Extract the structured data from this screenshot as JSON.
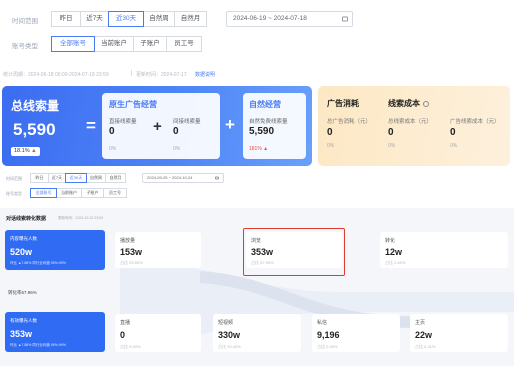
{
  "top_filters": {
    "time_label": "时间范围",
    "time_tabs": [
      "昨日",
      "近7天",
      "近30天",
      "自然周",
      "自然月"
    ],
    "date_range": "2024-06-19 ~ 2024-07-18",
    "account_label": "账号类型",
    "account_tabs": [
      "全部账号",
      "当前账户",
      "子账户",
      "员工号"
    ]
  },
  "meta": {
    "stat_period": "统计周期：2024-06-18 00:00-2024-07-18 23:59",
    "update_time": "更新时间：2024-07-17",
    "data_note": "数据说明"
  },
  "summary": {
    "total": {
      "title": "总线索量",
      "value": "5,590",
      "change": "18.1%"
    },
    "organic": {
      "title": "原生广告经营",
      "direct_label": "直接线索量",
      "direct_value": "0",
      "direct_pct": "0%",
      "indirect_label": "间接线索量",
      "indirect_value": "0",
      "indirect_pct": "0%"
    },
    "natural": {
      "title": "自然经营",
      "label": "自然免费线索量",
      "value": "5,590",
      "change": "181%"
    },
    "ads": {
      "title": "广告消耗",
      "lead_title": "线索成本",
      "spend_label": "总广告消耗（元）",
      "spend_value": "0",
      "spend_pct": "0%",
      "cost_label": "总线索成本（元）",
      "cost_value": "0",
      "cost_pct": "0%",
      "ad_cost_label": "广告线索成本（元）",
      "ad_cost_value": "0",
      "ad_cost_pct": "0%"
    }
  },
  "mid_filters": {
    "time_label": "时间范围",
    "time_tabs": [
      "昨日",
      "近7天",
      "近30天",
      "自然周",
      "自然月"
    ],
    "date_range": "2024-09-25 ~ 2024-10-24",
    "account_label": "账号类型",
    "account_tabs": [
      "全部账号",
      "当前账户",
      "子账户",
      "员工号"
    ]
  },
  "funnel": {
    "title": "对话线索转化数据",
    "update": "更新时间：2024-10-22 23:59",
    "exposure": {
      "title": "内容曝光人数",
      "value": "520w",
      "sub": "环比 ▲7.88%  同行业均值 95%-99%"
    },
    "conv_rate": "转化率67.96%",
    "engaged": {
      "title": "有效曝光人数",
      "value": "353w",
      "sub": "环比 ▲7.88%  同行业均值 95%-99%"
    },
    "cards_top": [
      {
        "title": "播放量",
        "value": "153w",
        "sub": "占比 29.55%"
      },
      {
        "title": "浏览",
        "value": "353w",
        "sub": "占比 67.99%"
      },
      {
        "title": "转化",
        "value": "12w",
        "sub": "占比 2.69%"
      }
    ],
    "cards_bottom": [
      {
        "title": "直播",
        "value": "0",
        "sub": "占比 0.00%"
      },
      {
        "title": "短视频",
        "value": "330w",
        "sub": "占比 93.43%"
      },
      {
        "title": "私信",
        "value": "9,196",
        "sub": "占比 0.26%"
      },
      {
        "title": "主页",
        "value": "22w",
        "sub": "占比 6.31%"
      }
    ]
  },
  "colors": {
    "accent": "#4a7bf7",
    "highlight": "#e03b2f",
    "up": "#f04c3c"
  }
}
